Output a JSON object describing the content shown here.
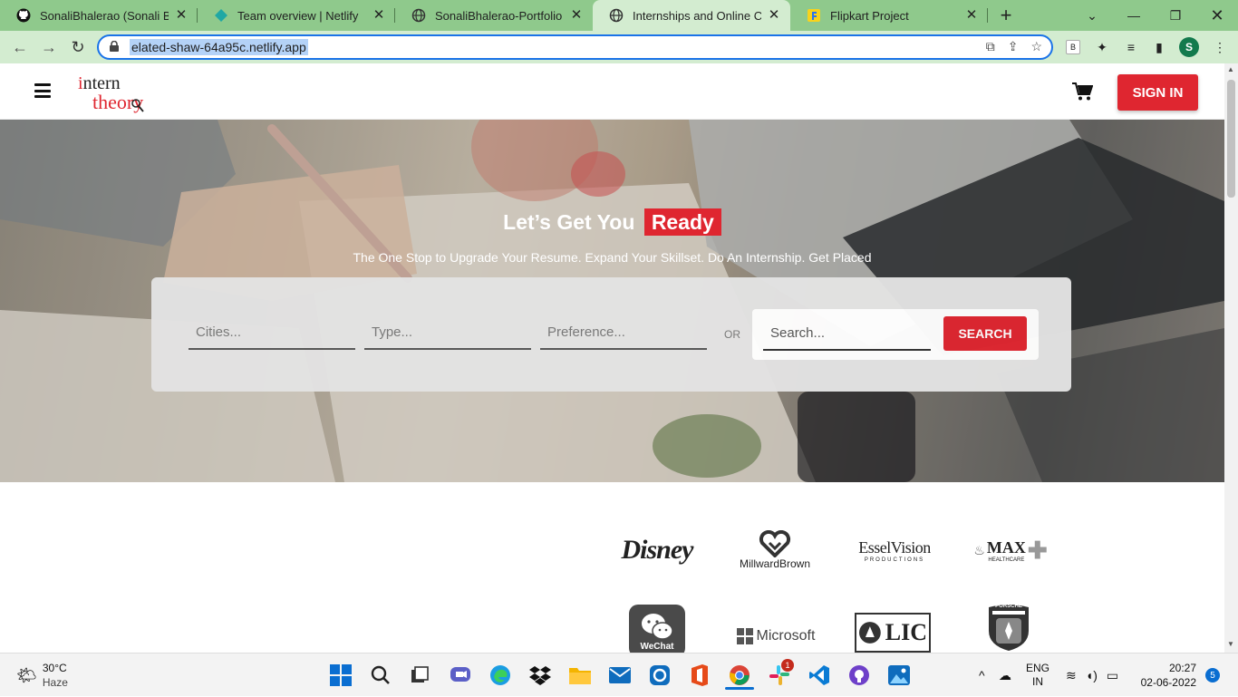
{
  "browser": {
    "tabs": [
      {
        "label": "SonaliBhalerao (Sonali Bhalerao)",
        "icon": "github-icon",
        "active": false
      },
      {
        "label": "Team overview | Netlify",
        "icon": "netlify-icon",
        "active": false
      },
      {
        "label": "SonaliBhalerao-Portfolio",
        "icon": "globe-icon",
        "active": false
      },
      {
        "label": "Internships and Online Courses",
        "icon": "globe-icon",
        "active": true
      },
      {
        "label": "Flipkart Project",
        "icon": "flipkart-icon",
        "active": false
      }
    ],
    "new_tab_label": "+",
    "url": "elated-shaw-64a95c.netlify.app",
    "profile_initial": "S",
    "extension_badge": "B",
    "colors": {
      "tabstrip": "#8fc98c",
      "toolbar": "#d3ecd0",
      "omnibox_focus": "#1a73e8"
    }
  },
  "site": {
    "logo_text_top": "intern",
    "logo_text_bottom": "theory",
    "signin_label": "SIGN IN",
    "accent": "#df2630",
    "hero": {
      "title": "Let’s Get You",
      "title_highlight": "Ready",
      "subtitle": "The One Stop to Upgrade Your Resume. Expand Your Skillset. Do An Internship. Get Placed"
    },
    "search": {
      "cities_placeholder": "Cities...",
      "type_placeholder": "Type...",
      "preference_placeholder": "Preference...",
      "or_label": "OR",
      "search_placeholder": "Search...",
      "search_button": "SEARCH"
    },
    "brands": {
      "disney": "Disney",
      "millward": "MillwardBrown",
      "essel": "EsselVision",
      "essel_sub": "PRODUCTIONS",
      "max": "MAX",
      "max_sub": "HEALTHCARE",
      "wechat": "WeChat",
      "microsoft": "Microsoft",
      "lic": "LIC",
      "porsche": "PORSCHE"
    }
  },
  "taskbar": {
    "weather_temp": "30°C",
    "weather_desc": "Haze",
    "lang_line1": "ENG",
    "lang_line2": "IN",
    "time": "20:27",
    "date": "02-06-2022",
    "notification_count": "5",
    "slack_badge": "1"
  }
}
